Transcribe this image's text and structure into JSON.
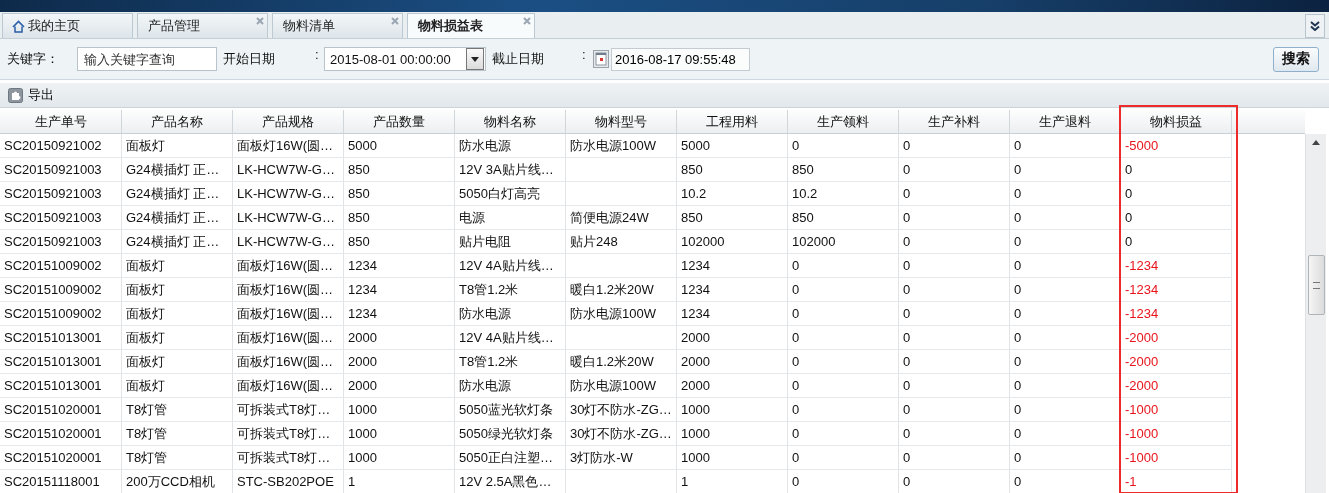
{
  "tabs": [
    {
      "label": "我的主页",
      "kind": "home",
      "selected": false,
      "closable": false
    },
    {
      "label": "产品管理",
      "kind": "page",
      "selected": false,
      "closable": true
    },
    {
      "label": "物料清单",
      "kind": "page",
      "selected": false,
      "closable": true
    },
    {
      "label": "物料损益表",
      "kind": "page",
      "selected": true,
      "closable": true
    }
  ],
  "filters": {
    "keyword_label": "关键字：",
    "keyword_placeholder": "输入关键字查询",
    "start_label": "开始日期",
    "start_colon": ":",
    "start_value": "2015-08-01 00:00:00",
    "end_label": "截止日期",
    "end_colon": ":",
    "end_value": "2016-08-17 09:55:48",
    "search_button": "搜索"
  },
  "toolbar": {
    "export_button": "导出"
  },
  "table": {
    "columns": [
      {
        "label": "生产单号",
        "highlighted": false
      },
      {
        "label": "产品名称",
        "highlighted": false
      },
      {
        "label": "产品规格",
        "highlighted": false
      },
      {
        "label": "产品数量",
        "highlighted": false
      },
      {
        "label": "物料名称",
        "highlighted": false
      },
      {
        "label": "物料型号",
        "highlighted": false
      },
      {
        "label": "工程用料",
        "highlighted": false
      },
      {
        "label": "生产领料",
        "highlighted": false
      },
      {
        "label": "生产补料",
        "highlighted": false
      },
      {
        "label": "生产退料",
        "highlighted": false
      },
      {
        "label": "物料损益",
        "highlighted": true
      }
    ],
    "rows": [
      {
        "cells": [
          "SC20150921002",
          "面板灯",
          "面板灯16W(圆…",
          "5000",
          "防水电源",
          "防水电源100W",
          "5000",
          "0",
          "0",
          "0",
          "-5000"
        ],
        "loss_negative": true
      },
      {
        "cells": [
          "SC20150921003",
          "G24横插灯 正…",
          "LK-HCW7W-G…",
          "850",
          "12V 3A贴片线…",
          "",
          "850",
          "850",
          "0",
          "0",
          "0"
        ],
        "loss_negative": false
      },
      {
        "cells": [
          "SC20150921003",
          "G24横插灯 正…",
          "LK-HCW7W-G…",
          "850",
          "5050白灯高亮",
          "",
          "10.2",
          "10.2",
          "0",
          "0",
          "0"
        ],
        "loss_negative": false
      },
      {
        "cells": [
          "SC20150921003",
          "G24横插灯 正…",
          "LK-HCW7W-G…",
          "850",
          "电源",
          "简便电源24W",
          "850",
          "850",
          "0",
          "0",
          "0"
        ],
        "loss_negative": false
      },
      {
        "cells": [
          "SC20150921003",
          "G24横插灯 正…",
          "LK-HCW7W-G…",
          "850",
          "贴片电阻",
          "贴片248",
          "102000",
          "102000",
          "0",
          "0",
          "0"
        ],
        "loss_negative": false
      },
      {
        "cells": [
          "SC20151009002",
          "面板灯",
          "面板灯16W(圆…",
          "1234",
          "12V 4A贴片线…",
          "",
          "1234",
          "0",
          "0",
          "0",
          "-1234"
        ],
        "loss_negative": true
      },
      {
        "cells": [
          "SC20151009002",
          "面板灯",
          "面板灯16W(圆…",
          "1234",
          "T8管1.2米",
          "暖白1.2米20W",
          "1234",
          "0",
          "0",
          "0",
          "-1234"
        ],
        "loss_negative": true
      },
      {
        "cells": [
          "SC20151009002",
          "面板灯",
          "面板灯16W(圆…",
          "1234",
          "防水电源",
          "防水电源100W",
          "1234",
          "0",
          "0",
          "0",
          "-1234"
        ],
        "loss_negative": true
      },
      {
        "cells": [
          "SC20151013001",
          "面板灯",
          "面板灯16W(圆…",
          "2000",
          "12V 4A贴片线…",
          "",
          "2000",
          "0",
          "0",
          "0",
          "-2000"
        ],
        "loss_negative": true
      },
      {
        "cells": [
          "SC20151013001",
          "面板灯",
          "面板灯16W(圆…",
          "2000",
          "T8管1.2米",
          "暖白1.2米20W",
          "2000",
          "0",
          "0",
          "0",
          "-2000"
        ],
        "loss_negative": true
      },
      {
        "cells": [
          "SC20151013001",
          "面板灯",
          "面板灯16W(圆…",
          "2000",
          "防水电源",
          "防水电源100W",
          "2000",
          "0",
          "0",
          "0",
          "-2000"
        ],
        "loss_negative": true
      },
      {
        "cells": [
          "SC20151020001",
          "T8灯管",
          "可拆装式T8灯…",
          "1000",
          "5050蓝光软灯条",
          "30灯不防水-ZG…",
          "1000",
          "0",
          "0",
          "0",
          "-1000"
        ],
        "loss_negative": true
      },
      {
        "cells": [
          "SC20151020001",
          "T8灯管",
          "可拆装式T8灯…",
          "1000",
          "5050绿光软灯条",
          "30灯不防水-ZG…",
          "1000",
          "0",
          "0",
          "0",
          "-1000"
        ],
        "loss_negative": true
      },
      {
        "cells": [
          "SC20151020001",
          "T8灯管",
          "可拆装式T8灯…",
          "1000",
          "5050正白注塑…",
          "3灯防水-W",
          "1000",
          "0",
          "0",
          "0",
          "-1000"
        ],
        "loss_negative": true
      },
      {
        "cells": [
          "SC20151118001",
          "200万CCD相机",
          "STC-SB202POE",
          "1",
          "12V 2.5A黑色…",
          "",
          "1",
          "0",
          "0",
          "0",
          "-1"
        ],
        "loss_negative": true
      }
    ]
  }
}
